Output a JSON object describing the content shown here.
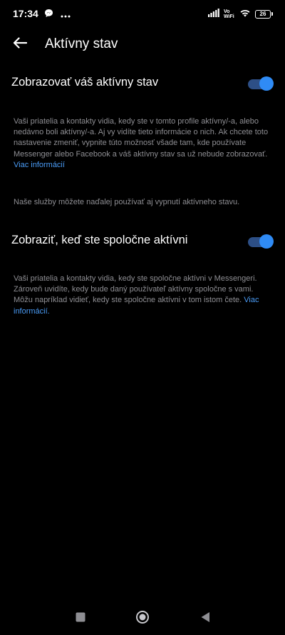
{
  "status_bar": {
    "time": "17:34",
    "vowifi": "Vo WiFi",
    "battery": "26"
  },
  "header": {
    "title": "Aktívny stav"
  },
  "settings": [
    {
      "label": "Zobrazovať váš aktívny stav",
      "enabled": true,
      "description": "Vaši priatelia a kontakty vidia, kedy ste v tomto profile aktívny/-a, alebo nedávno boli aktívny/-a. Aj vy vidíte tieto informácie o nich. Ak chcete toto nastavenie zmeniť, vypnite túto možnosť všade tam, kde používate Messenger alebo Facebook a váš aktívny stav sa už nebude zobrazovať.",
      "link": "Viac informácií",
      "note": "Naše služby môžete naďalej používať aj vypnutí aktívneho stavu."
    },
    {
      "label": "Zobraziť, keď ste spoločne aktívni",
      "enabled": true,
      "description": "Vaši priatelia a kontakty vidia, kedy ste spoločne aktívni v Messengeri. Zároveň uvidíte, kedy bude daný používateľ aktívny spoločne s vami. Môžu napríklad vidieť, kedy ste spoločne aktívni v tom istom čete.",
      "link": "Viac informácií."
    }
  ],
  "colors": {
    "background": "#000000",
    "toggle_thumb": "#2f8bf5",
    "toggle_track": "#2d4f86",
    "link": "#4a9bf5",
    "secondary_text": "#8e8e93"
  },
  "icons": {
    "back": "arrow-left-icon",
    "nav_recents": "square-icon",
    "nav_home": "circle-icon",
    "nav_back": "triangle-back-icon"
  }
}
